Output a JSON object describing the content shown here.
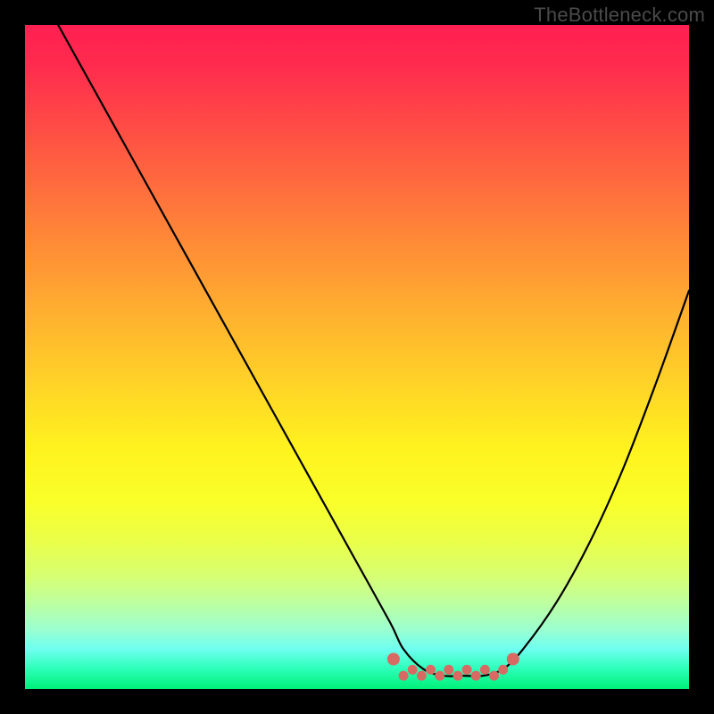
{
  "watermark": "TheBottleneck.com",
  "colors": {
    "background": "#000000",
    "curve_stroke": "#000000",
    "dot_fill": "#d86a63"
  },
  "chart_data": {
    "type": "line",
    "title": "",
    "xlabel": "",
    "ylabel": "",
    "xlim": [
      0,
      100
    ],
    "ylim": [
      0,
      100
    ],
    "grid": false,
    "series": [
      {
        "name": "bottleneck-curve",
        "x": [
          5,
          10,
          15,
          20,
          25,
          30,
          35,
          40,
          45,
          50,
          55,
          57,
          60,
          63,
          66,
          69,
          72,
          75,
          80,
          85,
          90,
          95,
          100
        ],
        "y": [
          100,
          91,
          82,
          73,
          64,
          55,
          46,
          37,
          28,
          19,
          10,
          6,
          3,
          2,
          2,
          2,
          3,
          6,
          13,
          22,
          33,
          46,
          60
        ]
      }
    ],
    "valley_marker": {
      "description": "salmon dotted band marking the minimum plateau",
      "x_range": [
        57,
        72
      ],
      "y": 2,
      "dot_count_approx": 12
    },
    "background_gradient": {
      "orientation": "vertical",
      "stops": [
        {
          "pos": 0.0,
          "color": "#ff2052"
        },
        {
          "pos": 0.14,
          "color": "#ff4747"
        },
        {
          "pos": 0.34,
          "color": "#ff8f36"
        },
        {
          "pos": 0.54,
          "color": "#ffd327"
        },
        {
          "pos": 0.72,
          "color": "#f9ff2a"
        },
        {
          "pos": 0.87,
          "color": "#beffa0"
        },
        {
          "pos": 1.0,
          "color": "#00f078"
        }
      ]
    }
  }
}
